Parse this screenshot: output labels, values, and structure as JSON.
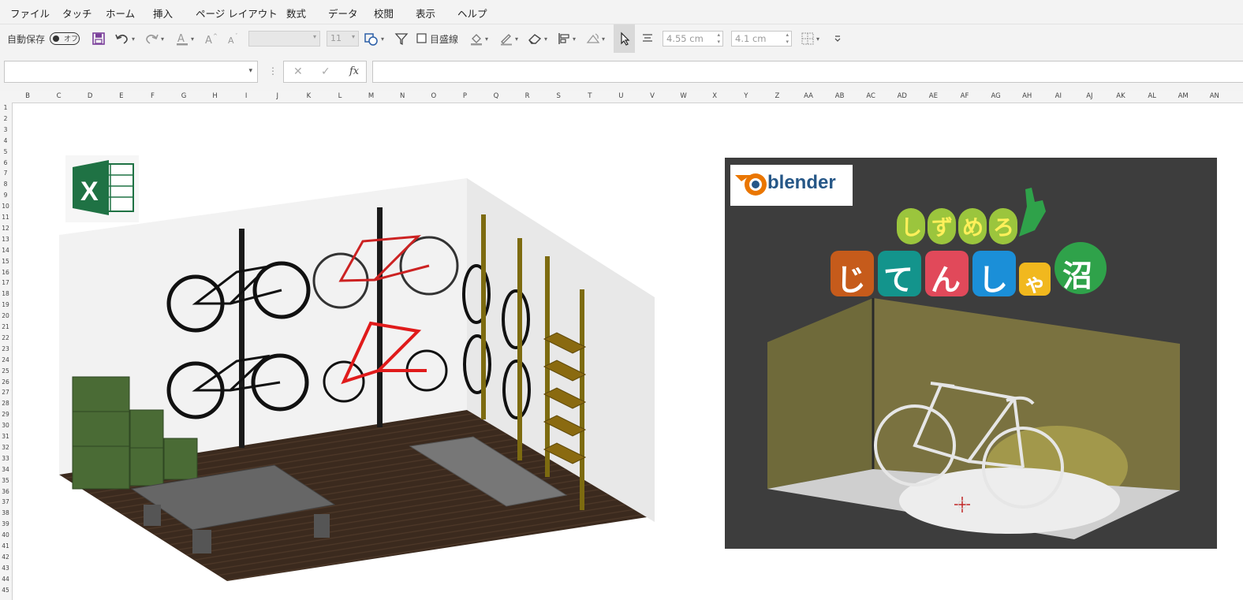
{
  "menu": [
    "ファイル",
    "タッチ",
    "ホーム",
    "挿入",
    "ページ レイアウト",
    "数式",
    "データ",
    "校閲",
    "表示",
    "ヘルプ"
  ],
  "ribbon": {
    "autosave_label": "自動保存",
    "autosave_state": "オフ",
    "font_size": "11",
    "gridlines_label": "目盛線",
    "height_value": "4.55 cm",
    "width_value": "4.1 cm"
  },
  "formula_bar": {
    "fx": "fx",
    "cancel": "✕",
    "enter": "✓"
  },
  "columns": [
    "B",
    "C",
    "D",
    "E",
    "F",
    "G",
    "H",
    "I",
    "J",
    "K",
    "L",
    "M",
    "N",
    "O",
    "P",
    "Q",
    "R",
    "S",
    "T",
    "U",
    "V",
    "W",
    "X",
    "Y",
    "Z",
    "AA",
    "AB",
    "AC",
    "AD",
    "AE",
    "AF",
    "AG",
    "AH",
    "AI",
    "AJ",
    "AK",
    "AL",
    "AM",
    "AN"
  ],
  "rows": [
    "1",
    "2",
    "3",
    "4",
    "5",
    "6",
    "7",
    "8",
    "9",
    "10",
    "11",
    "12",
    "13",
    "14",
    "15",
    "16",
    "17",
    "18",
    "19",
    "20",
    "21",
    "22",
    "23",
    "24",
    "25",
    "26",
    "27",
    "28",
    "29",
    "30",
    "31",
    "32",
    "33",
    "34",
    "35",
    "36",
    "37",
    "38",
    "39",
    "40",
    "41",
    "42",
    "43",
    "44",
    "45"
  ],
  "blender_card": {
    "logo_text": "blender",
    "title_top": [
      "し",
      "ず",
      "め",
      "ろ"
    ],
    "title_bottom": [
      "じ",
      "て",
      "ん",
      "し",
      "ゃ",
      "沼"
    ]
  },
  "colors": {
    "excel_green": "#1f7244",
    "floor_brown": "#3b2a1e",
    "box_green": "#4a6b35",
    "blender_bg": "#3d3d3d",
    "wall_olive": "#7a7240",
    "blender_orange": "#ea7600"
  },
  "icons": [
    "save-icon",
    "undo-icon",
    "redo-icon",
    "font-color-icon",
    "font-grow-icon",
    "font-shrink-icon",
    "shape-icon",
    "filter-icon",
    "fill-icon",
    "outline-icon",
    "eraser-icon",
    "align-icon",
    "rotate-icon",
    "select-arrow-icon",
    "text-align-icon",
    "borders-icon",
    "more-icon"
  ]
}
